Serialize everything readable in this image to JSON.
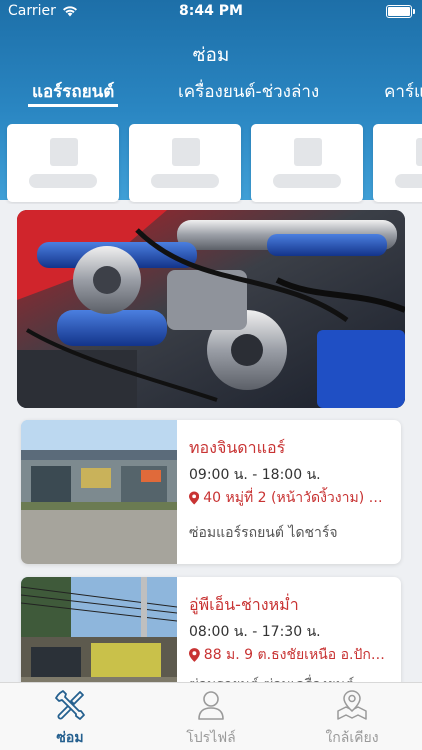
{
  "status_bar": {
    "carrier": "Carrier",
    "time": "8:44 PM"
  },
  "nav": {
    "title": "ซ่อม"
  },
  "tabs": [
    {
      "label": "แอร์รถยนต์",
      "active": true
    },
    {
      "label": "เครื่องยนต์-ช่วงล่าง",
      "active": false
    },
    {
      "label": "คาร์แ",
      "active": false
    }
  ],
  "shops": [
    {
      "name": "ทองจินดาแอร์",
      "hours": "09:00 น. - 18:00 น.",
      "address": "40 หมู่ที่ 2 (หน้าวัดงิ้วงาม) ต.ไ...",
      "description": "ซ่อมแอร์รถยนต์ ไดชาร์จ"
    },
    {
      "name": "อู่พีเอ็น-ช่างหม่ำ",
      "hours": "08:00 น. - 17:30 น.",
      "address": "88  ม. 9 ต.ธงชัยเหนือ อ.ปักธ...",
      "description": "ซ่อมรถยนต์ ซ่อมเครื่องยนต์"
    }
  ],
  "tab_bar": {
    "items": [
      {
        "label": "ซ่อม",
        "icon": "wrench-screwdriver-icon",
        "active": true
      },
      {
        "label": "โปรไฟล์",
        "icon": "person-icon",
        "active": false
      },
      {
        "label": "ใกล้เคียง",
        "icon": "map-pin-icon",
        "active": false
      }
    ]
  },
  "colors": {
    "header": "#1d6fa8",
    "accent_red": "#c83333",
    "tab_active": "#25608f"
  }
}
